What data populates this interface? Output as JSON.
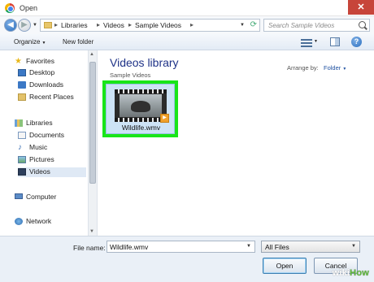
{
  "window": {
    "title": "Open",
    "close_glyph": "✕"
  },
  "address": {
    "crumbs": [
      "Libraries",
      "Videos",
      "Sample Videos"
    ],
    "separator": "▸",
    "search_placeholder": "Search Sample Videos"
  },
  "toolbar": {
    "organize": "Organize",
    "new_folder": "New folder"
  },
  "sidebar": {
    "favorites": "Favorites",
    "desktop": "Desktop",
    "downloads": "Downloads",
    "recent": "Recent Places",
    "libraries": "Libraries",
    "documents": "Documents",
    "music": "Music",
    "pictures": "Pictures",
    "videos": "Videos",
    "computer": "Computer",
    "network": "Network"
  },
  "content": {
    "title": "Videos library",
    "subtitle": "Sample Videos",
    "arrange_label": "Arrange by:",
    "arrange_value": "Folder",
    "file": {
      "name": "Wildlife.wmv",
      "highlight_color": "#19e519"
    }
  },
  "bottom": {
    "file_name_label": "File name:",
    "file_name_value": "Wildlife.wmv",
    "filter_value": "All Files",
    "open_label": "Open",
    "cancel_label": "Cancel"
  },
  "watermark": {
    "part1": "wiki",
    "part2": "How"
  }
}
